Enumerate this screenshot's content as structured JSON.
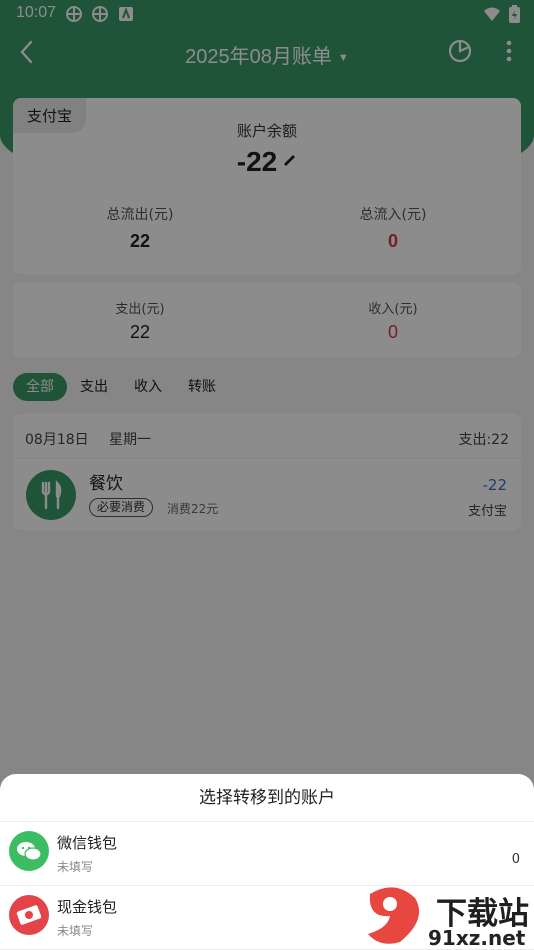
{
  "status_bar": {
    "time": "10:07"
  },
  "header": {
    "title": "2025年08月账单",
    "caret": "▼"
  },
  "balance_card": {
    "account_tag": "支付宝",
    "balance_label": "账户余额",
    "balance_value": "-22",
    "outflow_label": "总流出(元)",
    "outflow_value": "22",
    "inflow_label": "总流入(元)",
    "inflow_value": "0"
  },
  "summary_card": {
    "expense_label": "支出(元)",
    "expense_value": "22",
    "income_label": "收入(元)",
    "income_value": "0"
  },
  "filters": [
    {
      "label": "全部",
      "active": true
    },
    {
      "label": "支出",
      "active": false
    },
    {
      "label": "收入",
      "active": false
    },
    {
      "label": "转账",
      "active": false
    }
  ],
  "day_group": {
    "date": "08月18日",
    "weekday": "星期一",
    "summary": "支出:22",
    "entry": {
      "category": "餐饮",
      "badge": "必要消费",
      "note": "消费22元",
      "amount": "-22",
      "account": "支付宝"
    }
  },
  "sheet": {
    "title": "选择转移到的账户",
    "accounts": [
      {
        "name": "微信钱包",
        "sub": "未填写",
        "value": "0",
        "icon": "wechat-icon"
      },
      {
        "name": "现金钱包",
        "sub": "未填写",
        "value": "",
        "icon": "cash-icon"
      }
    ]
  },
  "watermark": {
    "text_top": "下载站",
    "text_bottom": "91xz.net"
  },
  "colors": {
    "accent": "#3b9968",
    "income_red": "#d9374c",
    "amount_blue": "#3a73c4"
  }
}
